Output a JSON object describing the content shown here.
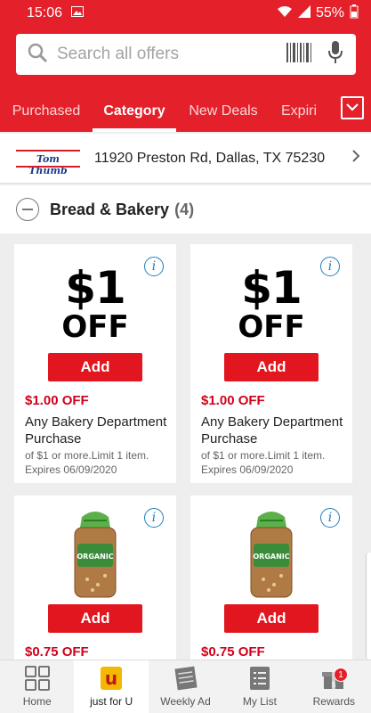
{
  "status": {
    "time": "15:06",
    "battery": "55%"
  },
  "search": {
    "placeholder": "Search all offers"
  },
  "tabs": [
    "Purchased",
    "Category",
    "New Deals",
    "Expiri"
  ],
  "store": {
    "logo_text": "Tom Thumb",
    "address": "11920 Preston Rd,  Dallas, TX 75230"
  },
  "category": {
    "title": "Bread & Bakery",
    "count": "(4)"
  },
  "cards": [
    {
      "img_big": "$1",
      "img_off": "OFF",
      "add": "Add",
      "price": "$1.00 OFF",
      "desc": "Any Bakery Department Purchase",
      "terms": "of $1 or more.Limit 1 item.",
      "expires": "Expires 06/09/2020"
    },
    {
      "img_big": "$1",
      "img_off": "OFF",
      "add": "Add",
      "price": "$1.00 OFF",
      "desc": "Any Bakery Department Purchase",
      "terms": "of $1 or more.Limit 1 item.",
      "expires": "Expires 06/09/2020"
    },
    {
      "add": "Add",
      "price": "$0.75 OFF",
      "bread_label": "ORGANIC"
    },
    {
      "add": "Add",
      "price": "$0.75 OFF",
      "bread_label": "ORGANIC"
    }
  ],
  "nav": [
    {
      "label": "Home",
      "icon": "grid-icon"
    },
    {
      "label": "just for U",
      "icon": "just-for-u-icon",
      "icon_text": "u"
    },
    {
      "label": "Weekly Ad",
      "icon": "newspaper-icon"
    },
    {
      "label": "My List",
      "icon": "list-icon"
    },
    {
      "label": "Rewards",
      "icon": "gift-icon",
      "badge": "1"
    }
  ],
  "colors": {
    "brand": "#e4202a",
    "price": "#d0021b",
    "info": "#1f7fbf"
  }
}
